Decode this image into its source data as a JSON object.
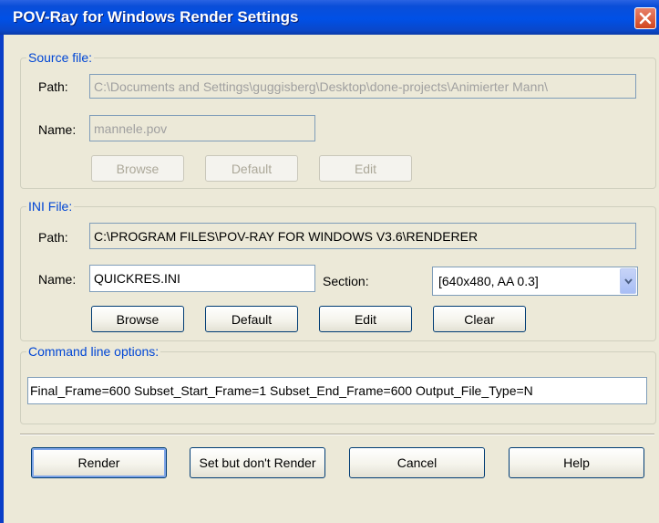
{
  "window": {
    "title": "POV-Ray for Windows Render Settings",
    "close_icon": "close-icon"
  },
  "source_file": {
    "legend": "Source file:",
    "path_label": "Path:",
    "path_value": "C:\\Documents and Settings\\guggisberg\\Desktop\\done-projects\\Animierter Mann\\",
    "name_label": "Name:",
    "name_value": "mannele.pov",
    "browse_label": "Browse",
    "default_label": "Default",
    "edit_label": "Edit"
  },
  "ini_file": {
    "legend": "INI File:",
    "path_label": "Path:",
    "path_value": "C:\\PROGRAM FILES\\POV-RAY FOR WINDOWS V3.6\\RENDERER",
    "name_label": "Name:",
    "name_value": "QUICKRES.INI",
    "section_label": "Section:",
    "section_value": "[640x480, AA 0.3]",
    "browse_label": "Browse",
    "default_label": "Default",
    "edit_label": "Edit",
    "clear_label": "Clear"
  },
  "command_line": {
    "legend": "Command line options:",
    "value": "Final_Frame=600 Subset_Start_Frame=1 Subset_End_Frame=600 Output_File_Type=N"
  },
  "actions": {
    "render_label": "Render",
    "set_label": "Set but don't Render",
    "cancel_label": "Cancel",
    "help_label": "Help"
  },
  "colors": {
    "titlebar": "#0050e6",
    "dialog_bg": "#ece9d8",
    "legend_text": "#0046d5",
    "close_button": "#d2461f"
  }
}
